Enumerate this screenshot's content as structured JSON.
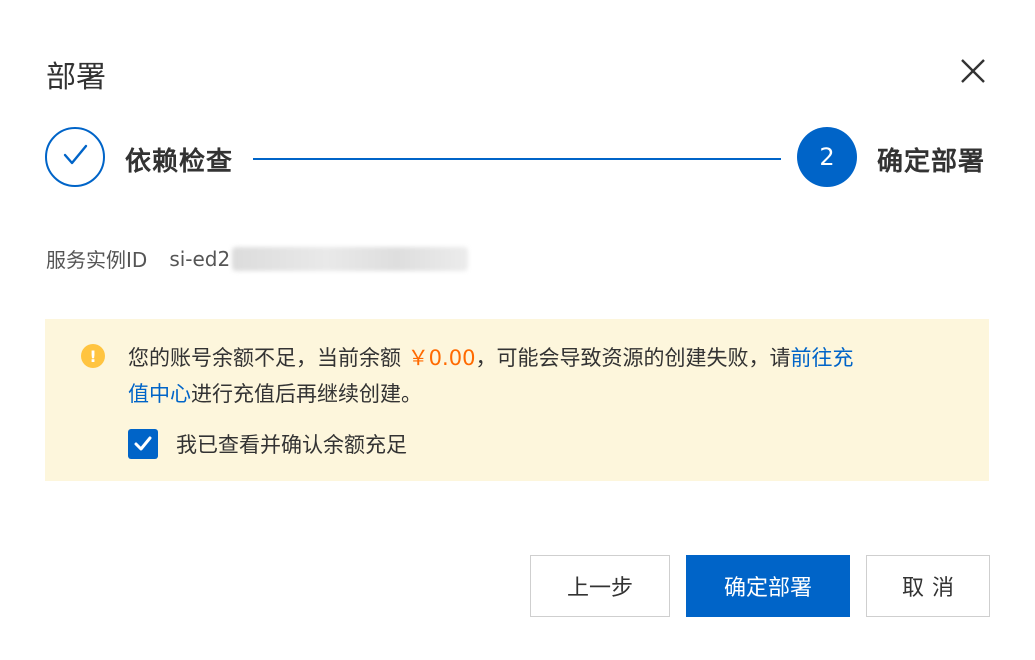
{
  "dialog": {
    "title": "部署",
    "close_icon": "close-icon"
  },
  "steps": [
    {
      "label": "依赖检查",
      "status": "done",
      "icon": "check-icon"
    },
    {
      "label": "确定部署",
      "status": "active",
      "number": "2"
    }
  ],
  "instance": {
    "label": "服务实例ID",
    "value_prefix": "si-ed2"
  },
  "notice": {
    "icon": "warning-icon",
    "text_before": "您的账号余额不足，当前余额",
    "amount": "￥0.00",
    "text_middle": "，可能会导致资源的创建失败，请",
    "link_part1": "前往充",
    "link_part2": "值中心",
    "text_after": "进行充值后再继续创建。",
    "checkbox_label": "我已查看并确认余额充足",
    "checkbox_checked": true
  },
  "buttons": {
    "prev": "上一步",
    "confirm": "确定部署",
    "cancel": "取消"
  },
  "colors": {
    "primary": "#0064c8",
    "warning_bg": "#fdf6dc",
    "amount": "#ff6a00",
    "warning_icon": "#ffc440"
  }
}
